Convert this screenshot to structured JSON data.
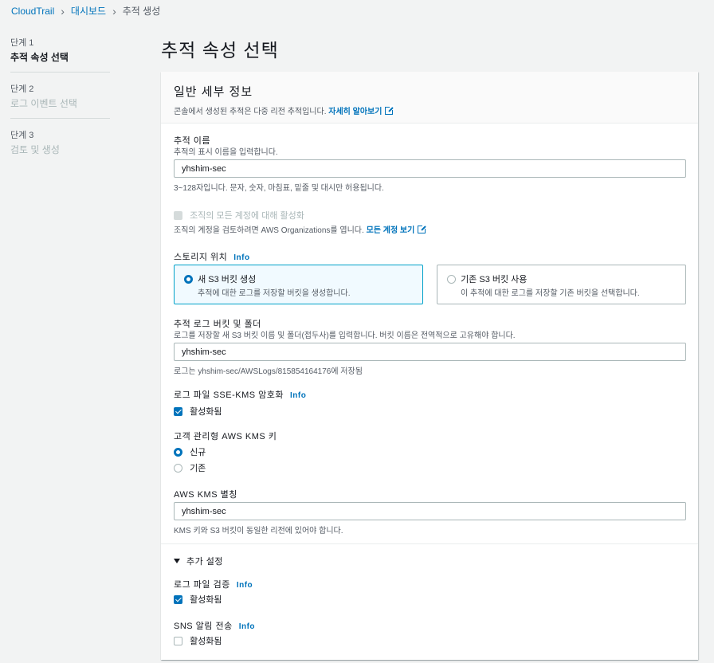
{
  "breadcrumb": [
    "CloudTrail",
    "대시보드",
    "추적 생성"
  ],
  "steps": [
    {
      "num": "단계 1",
      "name": "추적 속성 선택",
      "active": true
    },
    {
      "num": "단계 2",
      "name": "로그 이벤트 선택",
      "active": false
    },
    {
      "num": "단계 3",
      "name": "검토 및 생성",
      "active": false
    }
  ],
  "page_title": "추적 속성 선택",
  "panel": {
    "title": "일반 세부 정보",
    "desc": "콘솔에서 생성된 추적은 다중 리전 추적입니다.",
    "desc_link": "자세히 알아보기"
  },
  "trail_name": {
    "label": "추적 이름",
    "hint": "추적의 표시 이름을 입력합니다.",
    "value": "yhshim-sec",
    "constraint": "3~128자입니다. 문자, 숫자, 마침표, 밑줄 및 대시만 허용됩니다."
  },
  "org": {
    "label": "조직의 모든 계정에 대해 활성화",
    "hint": "조직의 계정을 검토하려면 AWS Organizations를 엽니다.",
    "link": "모든 계정 보기"
  },
  "storage": {
    "label": "스토리지 위치",
    "info": "Info",
    "options": [
      {
        "title": "새 S3 버킷 생성",
        "sub": "추적에 대한 로그를 저장할 버킷을 생성합니다.",
        "selected": true
      },
      {
        "title": "기존 S3 버킷 사용",
        "sub": "이 추적에 대한 로그를 저장할 기존 버킷을 선택합니다.",
        "selected": false
      }
    ]
  },
  "bucket": {
    "label": "추적 로그 버킷 및 폴더",
    "hint": "로그를 저장할 새 S3 버킷 이름 및 폴더(접두사)를 입력합니다. 버킷 이름은 전역적으로 고유해야 합니다.",
    "value": "yhshim-sec",
    "note": "로그는 yhshim-sec/AWSLogs/815854164176에 저장됨"
  },
  "sse": {
    "label": "로그 파일 SSE-KMS 암호화",
    "info": "Info",
    "checkbox": "활성화됨"
  },
  "kms_key": {
    "label": "고객 관리형 AWS KMS 키",
    "options": [
      "신규",
      "기존"
    ]
  },
  "kms_alias": {
    "label": "AWS KMS 별칭",
    "value": "yhshim-sec",
    "note": "KMS 키와 S3 버킷이 동일한 리전에 있어야 합니다."
  },
  "additional": {
    "title": "추가 설정",
    "validation_label": "로그 파일 검증",
    "validation_info": "Info",
    "validation_checkbox": "활성화됨",
    "sns_label": "SNS 알림 전송",
    "sns_info": "Info",
    "sns_checkbox": "활성화됨"
  },
  "colors": {
    "accent": "#0073bb",
    "selected_tile_bg": "#f1faff",
    "selected_tile_border": "#00a1c9"
  }
}
